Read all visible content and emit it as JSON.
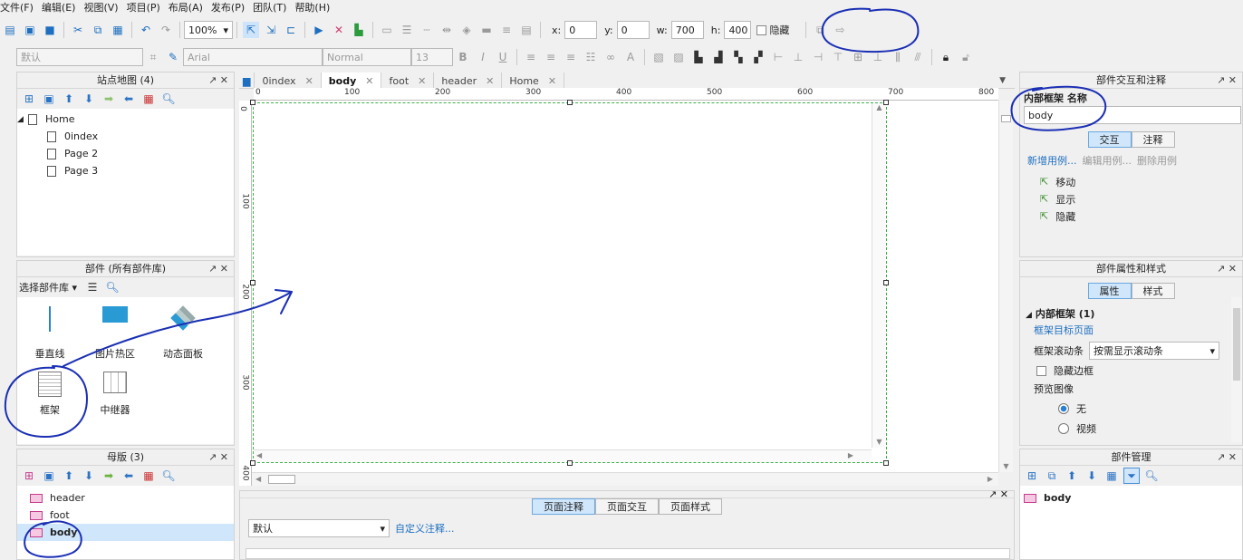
{
  "menu": [
    "文件(F)",
    "编辑(E)",
    "视图(V)",
    "项目(P)",
    "布局(A)",
    "发布(P)",
    "团队(T)",
    "帮助(H)"
  ],
  "toolbar": {
    "zoom": "100%",
    "x_label": "x:",
    "x_value": "0",
    "y_label": "y:",
    "y_value": "0",
    "w_label": "w:",
    "w_value": "700",
    "h_label": "h:",
    "h_value": "400",
    "hide_label": "隐藏",
    "style_default": "默认",
    "font": "Arial",
    "font_style": "Normal",
    "font_size": "13"
  },
  "sitemap": {
    "title": "站点地图 (4)",
    "pages": [
      "Home",
      "0index",
      "Page 2",
      "Page 3"
    ]
  },
  "widgets": {
    "title": "部件 (所有部件库)",
    "library_label": "选择部件库",
    "items": [
      "垂直线",
      "图片热区",
      "动态面板",
      "框架",
      "中继器"
    ]
  },
  "masters": {
    "title": "母版 (3)",
    "items": [
      "header",
      "foot",
      "body"
    ]
  },
  "tabs": [
    "0index",
    "body",
    "foot",
    "header",
    "Home"
  ],
  "active_tab": "body",
  "ruler": {
    "h": [
      "0",
      "100",
      "200",
      "300",
      "400",
      "500",
      "600",
      "700",
      "800"
    ],
    "v": [
      "0",
      "100",
      "200",
      "300",
      "400"
    ]
  },
  "page_notes": {
    "tabs": [
      "页面注释",
      "页面交互",
      "页面样式"
    ],
    "select_value": "默认",
    "custom_link": "自定义注释..."
  },
  "interaction_panel": {
    "title": "部件交互和注释",
    "name_label": "内部框架 名称",
    "name_value": "body",
    "tabs": [
      "交互",
      "注释"
    ],
    "actions": [
      "新增用例...",
      "编辑用例...",
      "删除用例"
    ],
    "events": [
      "移动",
      "显示",
      "隐藏"
    ]
  },
  "props_panel": {
    "title": "部件属性和样式",
    "tabs": [
      "属性",
      "样式"
    ],
    "section": "内部框架 (1)",
    "target_link": "框架目标页面",
    "scroll_label": "框架滚动条",
    "scroll_value": "按需显示滚动条",
    "hide_border": "隐藏边框",
    "preview_label": "预览图像",
    "opt_none": "无",
    "opt_video": "视频"
  },
  "manager_panel": {
    "title": "部件管理",
    "item": "body"
  }
}
